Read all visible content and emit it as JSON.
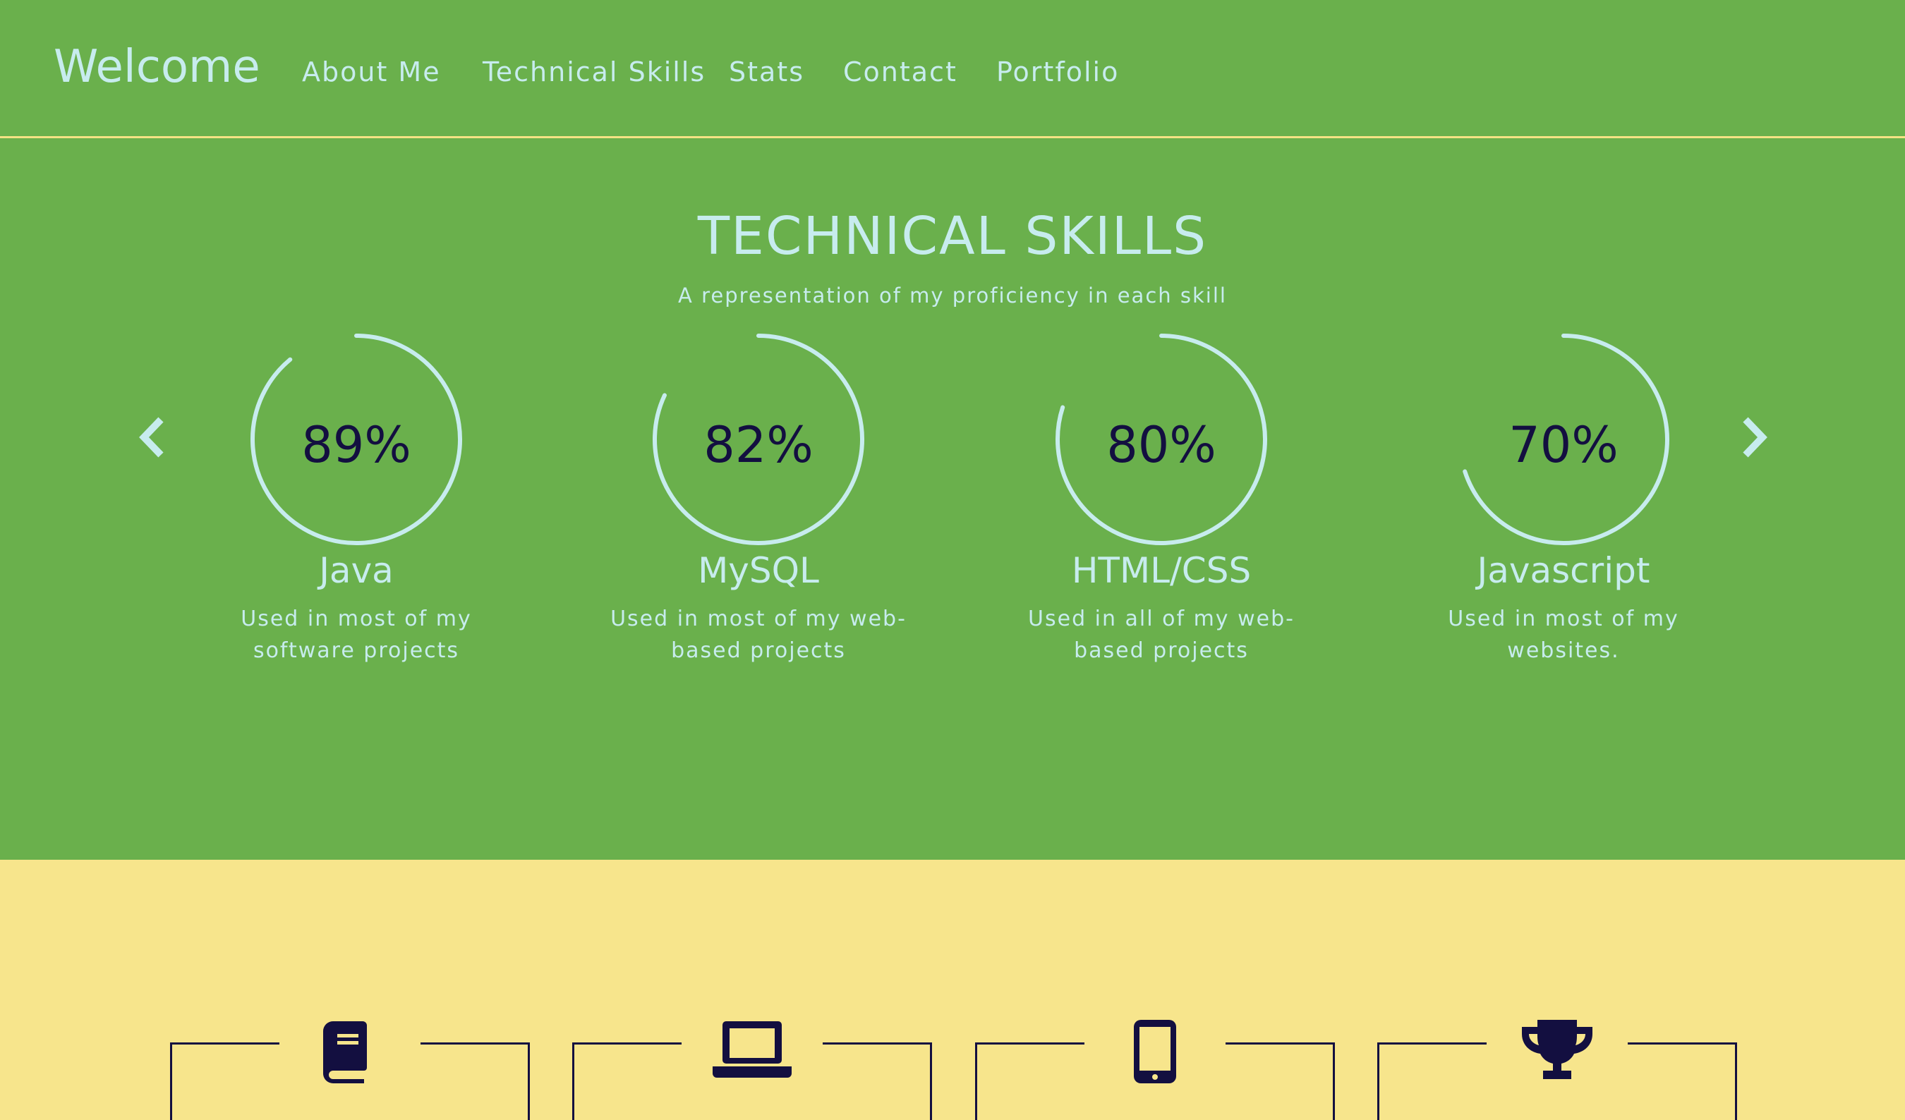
{
  "nav": {
    "brand": "Welcome",
    "items": [
      {
        "label": "About Me"
      },
      {
        "label": "Technical Skills"
      },
      {
        "label": "Stats"
      },
      {
        "label": "Contact"
      },
      {
        "label": "Portfolio"
      }
    ]
  },
  "skills_section": {
    "title": "TECHNICAL SKILLS",
    "subtitle": "A representation of my proficiency in each skill",
    "prev_icon": "chevron-left-icon",
    "next_icon": "chevron-right-icon",
    "skills": [
      {
        "percent_label": "89%",
        "value": 89,
        "name": "Java",
        "description": "Used in most of my software projects"
      },
      {
        "percent_label": "82%",
        "value": 82,
        "name": "MySQL",
        "description": "Used in most of my web-based projects"
      },
      {
        "percent_label": "80%",
        "value": 80,
        "name": "HTML/CSS",
        "description": "Used in all of my web-based projects"
      },
      {
        "percent_label": "70%",
        "value": 70,
        "name": "Javascript",
        "description": "Used in most of my websites."
      }
    ]
  },
  "stats_section": {
    "icons": [
      "book-icon",
      "laptop-icon",
      "mobile-phone-icon",
      "trophy-icon"
    ]
  },
  "colors": {
    "green_background": "#6ab04c",
    "yellow_background": "#f7e58c",
    "light_text": "#c7ecee",
    "dark_text": "#130f40",
    "nav_border": "#f4e285"
  }
}
